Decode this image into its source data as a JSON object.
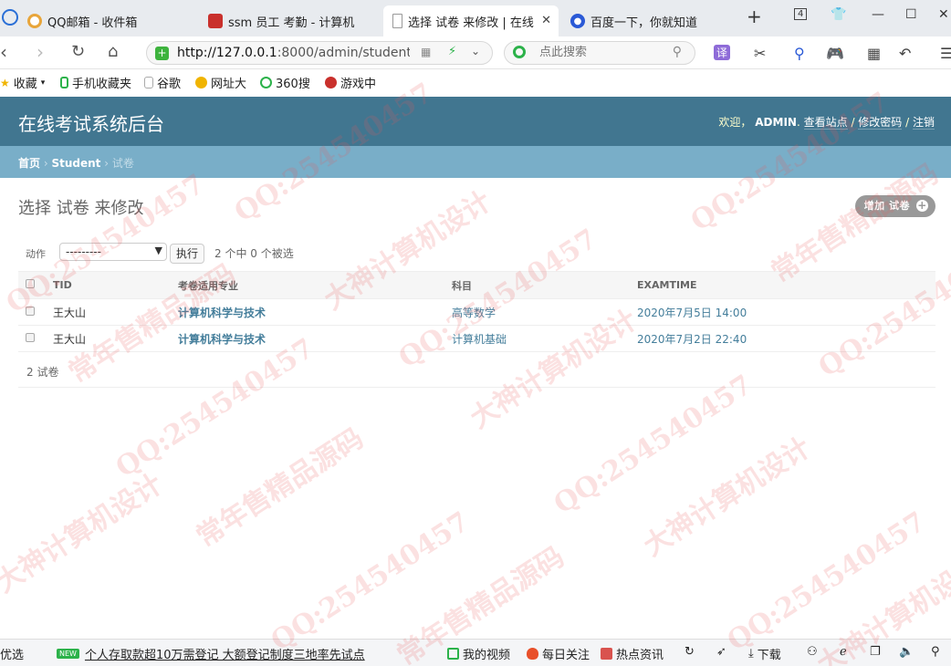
{
  "browser": {
    "tabs": [
      {
        "label": "QQ邮箱 - 收件箱"
      },
      {
        "label": "ssm 员工 考勤 - 计算机"
      },
      {
        "label": "选择 试卷 来修改 | 在线"
      },
      {
        "label": "百度一下，你就知道"
      }
    ],
    "tab_count": "4",
    "new_tab": "+",
    "address": {
      "host": "http://127.0.0.1",
      "rest": ":8000/admin/student/p"
    },
    "search_placeholder": "点此搜索",
    "bookmarks": [
      {
        "label": "收藏"
      },
      {
        "label": "手机收藏夹"
      },
      {
        "label": "谷歌"
      },
      {
        "label": "网址大"
      },
      {
        "label": "360搜"
      },
      {
        "label": "游戏中"
      }
    ],
    "toolbar_translate": "译"
  },
  "header": {
    "site_title": "在线考试系统后台",
    "welcome": "欢迎，",
    "username": "ADMIN",
    "view_site": "查看站点",
    "change_password": "修改密码",
    "logout": "注销"
  },
  "breadcrumbs": {
    "home": "首页",
    "app": "Student",
    "model": "试卷"
  },
  "content": {
    "title": "选择 试卷 来修改",
    "add_button": "增加 试卷",
    "actions": {
      "label": "动作",
      "select_value": "---------",
      "go_button": "执行",
      "counter": "2 个中 0 个被选"
    },
    "table": {
      "columns": [
        "TID",
        "考卷适用专业",
        "科目",
        "EXAMTIME"
      ],
      "rows": [
        {
          "tid": "王大山",
          "major": "计算机科学与技术",
          "subject": "高等数学",
          "time": "2020年7月5日 14:00"
        },
        {
          "tid": "王大山",
          "major": "计算机科学与技术",
          "subject": "计算机基础",
          "time": "2020年7月2日 22:40"
        }
      ]
    },
    "paginator": "2 试卷"
  },
  "statusbar": {
    "left": "优选",
    "news_badge": "NEW",
    "news": "个人存取款超10万需登记 大额登记制度三地率先试点",
    "my_video": "我的视频",
    "daily": "每日关注",
    "hot": "热点资讯",
    "download": "下载"
  },
  "watermarks": [
    "QQ:254540457",
    "常年售精品源码",
    "大神计算机设计"
  ]
}
